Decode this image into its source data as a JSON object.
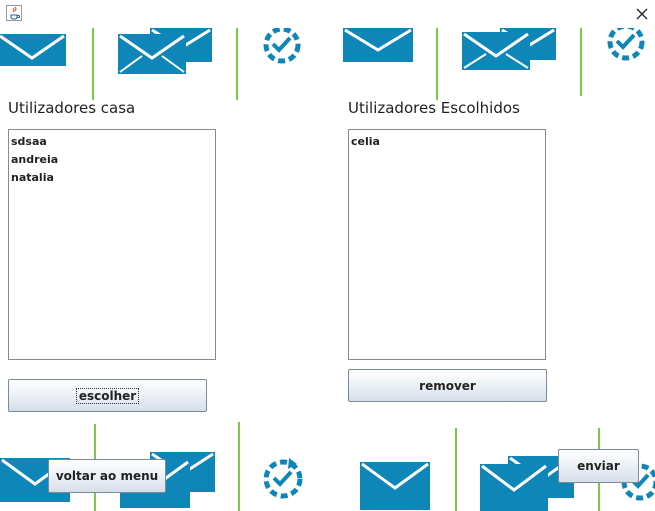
{
  "window": {
    "close_icon": "close-icon",
    "app_icon": "java-icon"
  },
  "left_panel": {
    "label": "Utilizadores casa",
    "items": [
      "sdsaa",
      "andreia",
      "natalia"
    ],
    "button": "escolher"
  },
  "right_panel": {
    "label": "Utilizadores Escolhidos",
    "items": [
      "celia"
    ],
    "button": "remover"
  },
  "bottom": {
    "back_button": "voltar ao menu",
    "send_button": "enviar"
  },
  "colors": {
    "envelope": "#0f86b8",
    "divider": "#7ac943",
    "button_border": "#7a8a99"
  }
}
